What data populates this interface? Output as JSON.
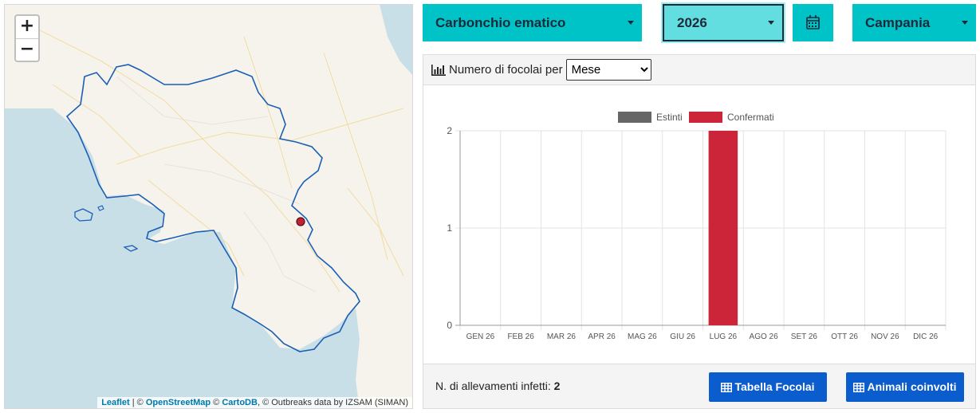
{
  "filters": {
    "disease": "Carbonchio ematico",
    "year": "2026",
    "calendar_icon": "calendar-icon",
    "region": "Campania"
  },
  "map": {
    "zoom_in": "+",
    "zoom_out": "−",
    "attribution": {
      "leaflet": "Leaflet",
      "sep1": " | © ",
      "osm": "OpenStreetMap",
      "sep2": " © ",
      "carto": "CartoDB",
      "rest": ", © Outbreaks data by IZSAM (SIMAN)"
    },
    "colors": {
      "sea": "#c9dfe8",
      "land": "#f6f3ec",
      "border": "#1a5fb4",
      "marker": "#c02434"
    }
  },
  "panel": {
    "title": "Numero di focolai per",
    "chart_icon": "bar-chart-icon",
    "period_options": [
      "Mese"
    ],
    "period_selected": "Mese"
  },
  "chart_data": {
    "type": "bar",
    "categories": [
      "GEN 26",
      "FEB 26",
      "MAR 26",
      "APR 26",
      "MAG 26",
      "GIU 26",
      "LUG 26",
      "AGO 26",
      "SET 26",
      "OTT 26",
      "NOV 26",
      "DIC 26"
    ],
    "series": [
      {
        "name": "Estinti",
        "color": "#666666",
        "values": [
          0,
          0,
          0,
          0,
          0,
          0,
          0,
          0,
          0,
          0,
          0,
          0
        ]
      },
      {
        "name": "Confermati",
        "color": "#cc2438",
        "values": [
          0,
          0,
          0,
          0,
          0,
          0,
          2,
          0,
          0,
          0,
          0,
          0
        ]
      }
    ],
    "ylim": [
      0,
      2
    ],
    "yticks": [
      0,
      1,
      2
    ],
    "grid": true,
    "legend": "top"
  },
  "footer": {
    "label": "N. di allevamenti infetti:",
    "count": "2",
    "btn_tabella": "Tabella Focolai",
    "btn_animali": "Animali coinvolti",
    "table_icon": "table-icon"
  }
}
